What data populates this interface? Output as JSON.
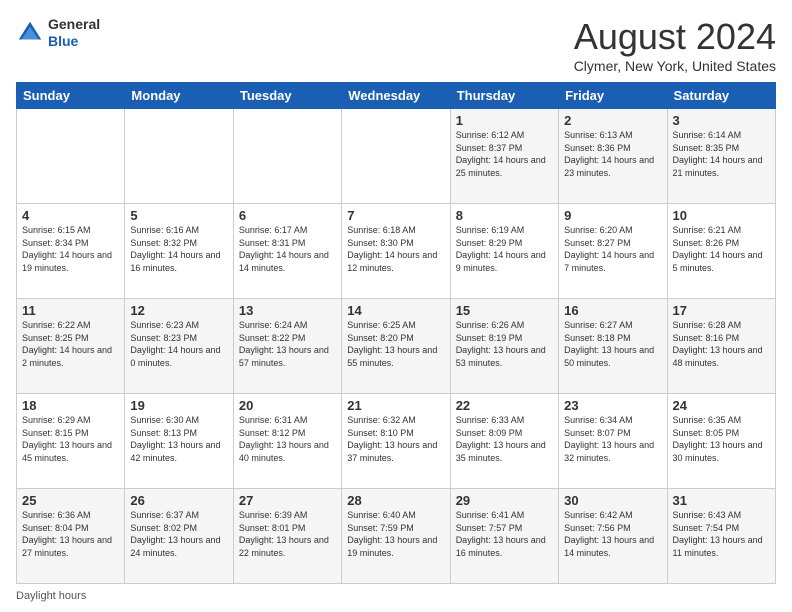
{
  "header": {
    "logo_line1": "General",
    "logo_line2": "Blue",
    "month_title": "August 2024",
    "location": "Clymer, New York, United States"
  },
  "days_of_week": [
    "Sunday",
    "Monday",
    "Tuesday",
    "Wednesday",
    "Thursday",
    "Friday",
    "Saturday"
  ],
  "weeks": [
    [
      {
        "day": "",
        "info": ""
      },
      {
        "day": "",
        "info": ""
      },
      {
        "day": "",
        "info": ""
      },
      {
        "day": "",
        "info": ""
      },
      {
        "day": "1",
        "info": "Sunrise: 6:12 AM\nSunset: 8:37 PM\nDaylight: 14 hours and 25 minutes."
      },
      {
        "day": "2",
        "info": "Sunrise: 6:13 AM\nSunset: 8:36 PM\nDaylight: 14 hours and 23 minutes."
      },
      {
        "day": "3",
        "info": "Sunrise: 6:14 AM\nSunset: 8:35 PM\nDaylight: 14 hours and 21 minutes."
      }
    ],
    [
      {
        "day": "4",
        "info": "Sunrise: 6:15 AM\nSunset: 8:34 PM\nDaylight: 14 hours and 19 minutes."
      },
      {
        "day": "5",
        "info": "Sunrise: 6:16 AM\nSunset: 8:32 PM\nDaylight: 14 hours and 16 minutes."
      },
      {
        "day": "6",
        "info": "Sunrise: 6:17 AM\nSunset: 8:31 PM\nDaylight: 14 hours and 14 minutes."
      },
      {
        "day": "7",
        "info": "Sunrise: 6:18 AM\nSunset: 8:30 PM\nDaylight: 14 hours and 12 minutes."
      },
      {
        "day": "8",
        "info": "Sunrise: 6:19 AM\nSunset: 8:29 PM\nDaylight: 14 hours and 9 minutes."
      },
      {
        "day": "9",
        "info": "Sunrise: 6:20 AM\nSunset: 8:27 PM\nDaylight: 14 hours and 7 minutes."
      },
      {
        "day": "10",
        "info": "Sunrise: 6:21 AM\nSunset: 8:26 PM\nDaylight: 14 hours and 5 minutes."
      }
    ],
    [
      {
        "day": "11",
        "info": "Sunrise: 6:22 AM\nSunset: 8:25 PM\nDaylight: 14 hours and 2 minutes."
      },
      {
        "day": "12",
        "info": "Sunrise: 6:23 AM\nSunset: 8:23 PM\nDaylight: 14 hours and 0 minutes."
      },
      {
        "day": "13",
        "info": "Sunrise: 6:24 AM\nSunset: 8:22 PM\nDaylight: 13 hours and 57 minutes."
      },
      {
        "day": "14",
        "info": "Sunrise: 6:25 AM\nSunset: 8:20 PM\nDaylight: 13 hours and 55 minutes."
      },
      {
        "day": "15",
        "info": "Sunrise: 6:26 AM\nSunset: 8:19 PM\nDaylight: 13 hours and 53 minutes."
      },
      {
        "day": "16",
        "info": "Sunrise: 6:27 AM\nSunset: 8:18 PM\nDaylight: 13 hours and 50 minutes."
      },
      {
        "day": "17",
        "info": "Sunrise: 6:28 AM\nSunset: 8:16 PM\nDaylight: 13 hours and 48 minutes."
      }
    ],
    [
      {
        "day": "18",
        "info": "Sunrise: 6:29 AM\nSunset: 8:15 PM\nDaylight: 13 hours and 45 minutes."
      },
      {
        "day": "19",
        "info": "Sunrise: 6:30 AM\nSunset: 8:13 PM\nDaylight: 13 hours and 42 minutes."
      },
      {
        "day": "20",
        "info": "Sunrise: 6:31 AM\nSunset: 8:12 PM\nDaylight: 13 hours and 40 minutes."
      },
      {
        "day": "21",
        "info": "Sunrise: 6:32 AM\nSunset: 8:10 PM\nDaylight: 13 hours and 37 minutes."
      },
      {
        "day": "22",
        "info": "Sunrise: 6:33 AM\nSunset: 8:09 PM\nDaylight: 13 hours and 35 minutes."
      },
      {
        "day": "23",
        "info": "Sunrise: 6:34 AM\nSunset: 8:07 PM\nDaylight: 13 hours and 32 minutes."
      },
      {
        "day": "24",
        "info": "Sunrise: 6:35 AM\nSunset: 8:05 PM\nDaylight: 13 hours and 30 minutes."
      }
    ],
    [
      {
        "day": "25",
        "info": "Sunrise: 6:36 AM\nSunset: 8:04 PM\nDaylight: 13 hours and 27 minutes."
      },
      {
        "day": "26",
        "info": "Sunrise: 6:37 AM\nSunset: 8:02 PM\nDaylight: 13 hours and 24 minutes."
      },
      {
        "day": "27",
        "info": "Sunrise: 6:39 AM\nSunset: 8:01 PM\nDaylight: 13 hours and 22 minutes."
      },
      {
        "day": "28",
        "info": "Sunrise: 6:40 AM\nSunset: 7:59 PM\nDaylight: 13 hours and 19 minutes."
      },
      {
        "day": "29",
        "info": "Sunrise: 6:41 AM\nSunset: 7:57 PM\nDaylight: 13 hours and 16 minutes."
      },
      {
        "day": "30",
        "info": "Sunrise: 6:42 AM\nSunset: 7:56 PM\nDaylight: 13 hours and 14 minutes."
      },
      {
        "day": "31",
        "info": "Sunrise: 6:43 AM\nSunset: 7:54 PM\nDaylight: 13 hours and 11 minutes."
      }
    ]
  ],
  "footer": {
    "daylight_label": "Daylight hours"
  }
}
